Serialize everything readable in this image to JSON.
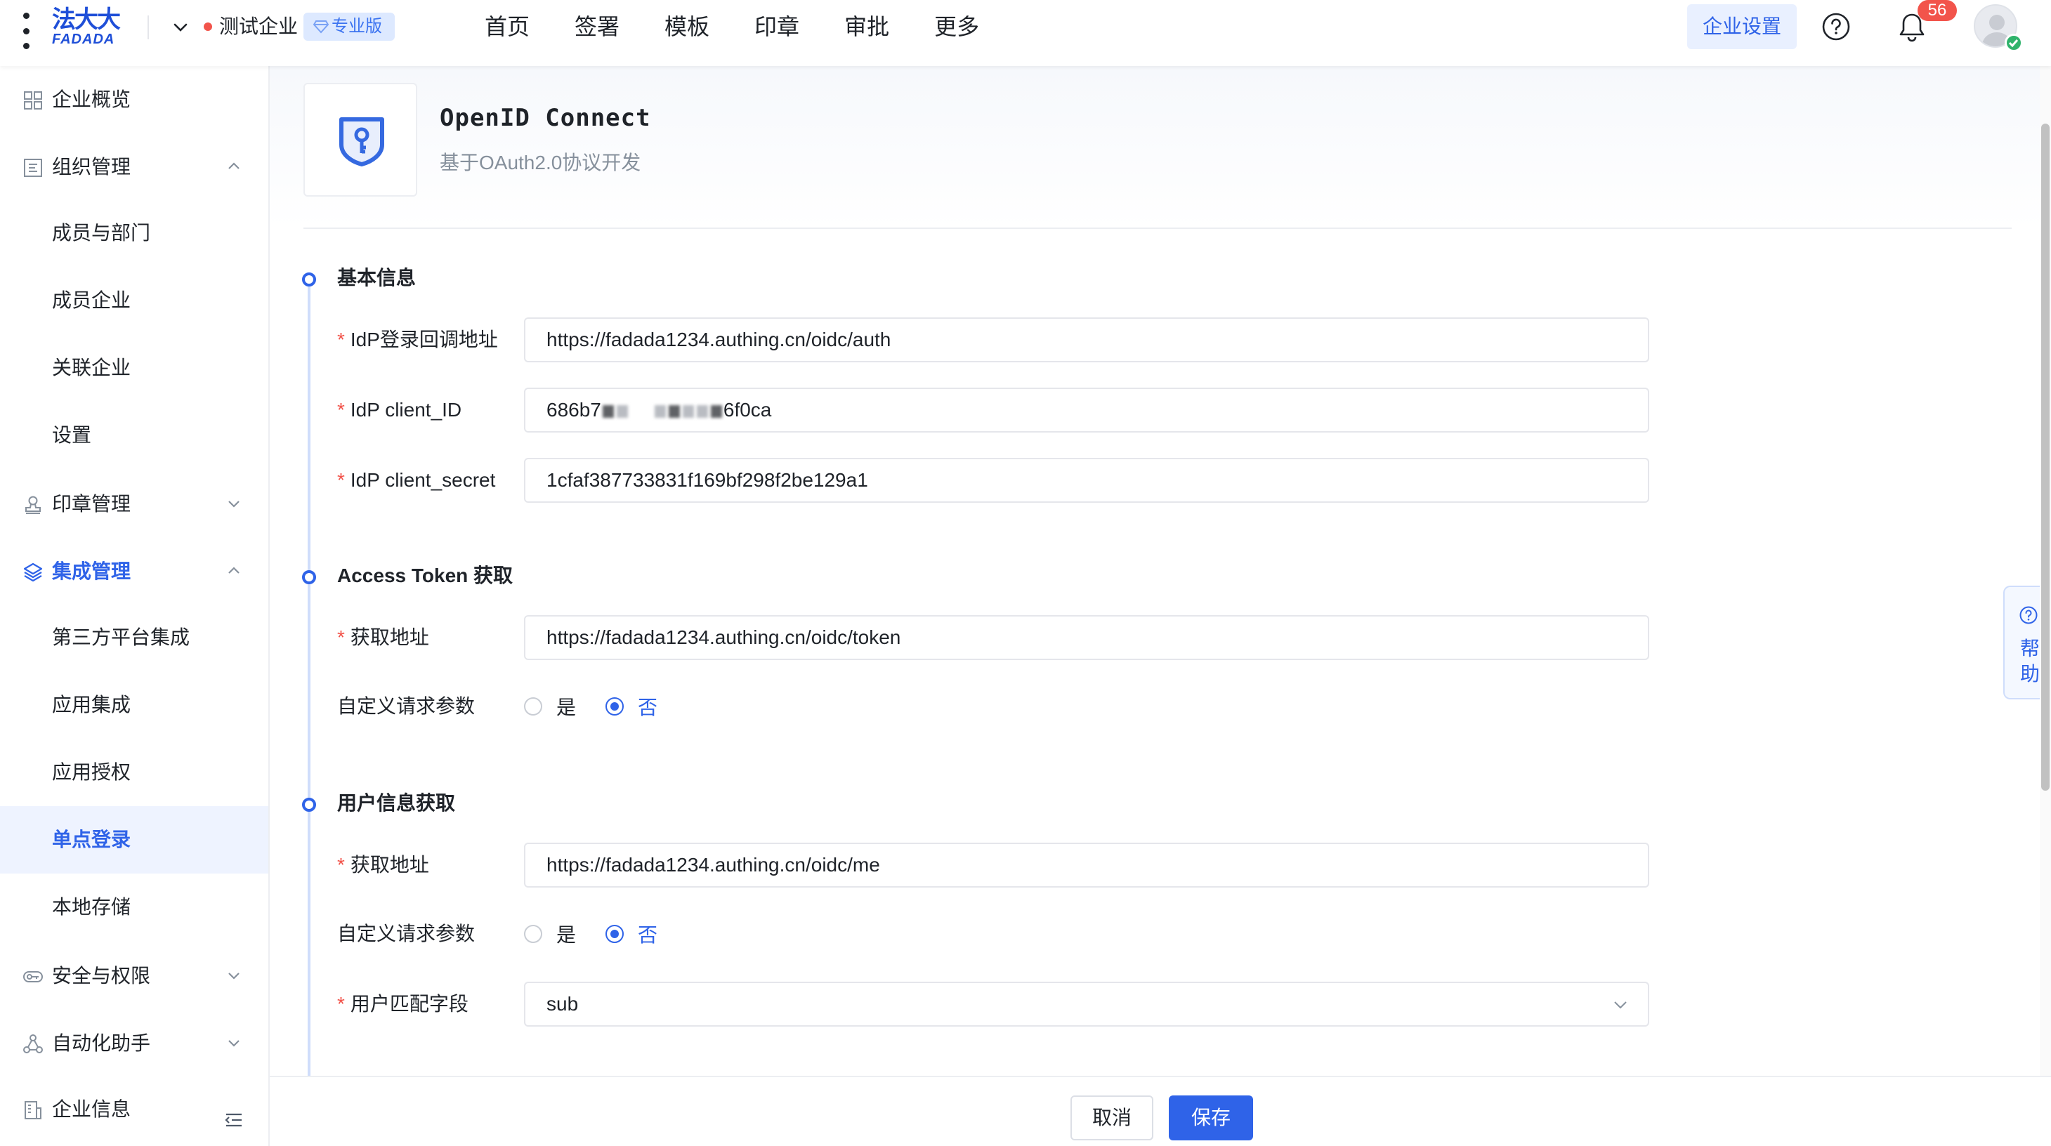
{
  "header": {
    "logo_cn": "法大大",
    "logo_en": "FADADA",
    "company_name": "测试企业",
    "edition": "专业版",
    "nav": [
      "首页",
      "签署",
      "模板",
      "印章",
      "审批",
      "更多"
    ],
    "settings_label": "企业设置",
    "notification_count": "56"
  },
  "sidebar": {
    "items": [
      {
        "label": "企业概览"
      },
      {
        "label": "组织管理"
      },
      {
        "label": "成员与部门"
      },
      {
        "label": "成员企业"
      },
      {
        "label": "关联企业"
      },
      {
        "label": "设置"
      },
      {
        "label": "印章管理"
      },
      {
        "label": "集成管理"
      },
      {
        "label": "第三方平台集成"
      },
      {
        "label": "应用集成"
      },
      {
        "label": "应用授权"
      },
      {
        "label": "单点登录"
      },
      {
        "label": "本地存储"
      },
      {
        "label": "安全与权限"
      },
      {
        "label": "自动化助手"
      },
      {
        "label": "企业信息"
      }
    ]
  },
  "provider": {
    "title": "OpenID Connect",
    "subtitle": "基于OAuth2.0协议开发"
  },
  "sections": {
    "basic": {
      "title": "基本信息",
      "callback_label": "IdP登录回调地址",
      "callback_value": "https://fadada1234.authing.cn/oidc/auth",
      "client_id_label": "IdP client_ID",
      "client_id_prefix": "686b7",
      "client_id_suffix": "6f0ca",
      "client_secret_label": "IdP client_secret",
      "client_secret_value": "1cfaf387733831f169bf298f2be129a1"
    },
    "token": {
      "title": "Access Token 获取",
      "url_label": "获取地址",
      "url_value": "https://fadada1234.authing.cn/oidc/token",
      "custom_label": "自定义请求参数",
      "yes": "是",
      "no": "否"
    },
    "userinfo": {
      "title": "用户信息获取",
      "url_label": "获取地址",
      "url_value": "https://fadada1234.authing.cn/oidc/me",
      "custom_label": "自定义请求参数",
      "yes": "是",
      "no": "否",
      "match_label": "用户匹配字段",
      "match_value": "sub"
    }
  },
  "footer": {
    "cancel": "取消",
    "save": "保存"
  },
  "help_float": "帮助",
  "colors": {
    "accent": "#2f63e8",
    "required": "#f2544b",
    "badge": "#f2544b"
  }
}
